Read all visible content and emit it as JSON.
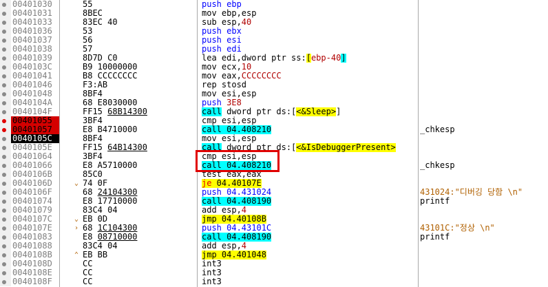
{
  "rows": [
    {
      "addr": "00401030",
      "hex": "55",
      "asm": [
        [
          "push",
          "t-push"
        ],
        [
          " ebp",
          "t-push"
        ]
      ],
      "cmt": "",
      "mark": "dot"
    },
    {
      "addr": "00401031",
      "hex": "8BEC",
      "asm": [
        [
          "mov ebp,esp",
          "t-mn"
        ]
      ],
      "cmt": "",
      "mark": "dot"
    },
    {
      "addr": "00401033",
      "hex": "83EC 40",
      "asm": [
        [
          "sub esp,",
          "t-mn"
        ],
        [
          "40",
          "t-num"
        ]
      ],
      "cmt": "",
      "mark": "dot"
    },
    {
      "addr": "00401036",
      "hex": "53",
      "asm": [
        [
          "push ebx",
          "t-push"
        ]
      ],
      "cmt": "",
      "mark": "dot"
    },
    {
      "addr": "00401037",
      "hex": "56",
      "asm": [
        [
          "push esi",
          "t-push"
        ]
      ],
      "cmt": "",
      "mark": "dot"
    },
    {
      "addr": "00401038",
      "hex": "57",
      "asm": [
        [
          "push edi",
          "t-push"
        ]
      ],
      "cmt": "",
      "mark": "dot"
    },
    {
      "addr": "00401039",
      "hex": "8D7D C0",
      "asm": [
        [
          "lea edi,dword ptr ss:",
          "t-mn"
        ],
        [
          "[",
          "t-api"
        ],
        [
          "ebp-40",
          "t-num"
        ],
        [
          "]",
          "t-call"
        ]
      ],
      "cmt": "",
      "mark": "dot"
    },
    {
      "addr": "0040103C",
      "hex": "B9 10000000",
      "asm": [
        [
          "mov ecx,",
          "t-mn"
        ],
        [
          "10",
          "t-num"
        ]
      ],
      "cmt": "",
      "mark": "dot"
    },
    {
      "addr": "00401041",
      "hex": "B8 CCCCCCCC",
      "asm": [
        [
          "mov eax,",
          "t-mn"
        ],
        [
          "CCCCCCCC",
          "t-num"
        ]
      ],
      "cmt": "",
      "mark": "dot"
    },
    {
      "addr": "00401046",
      "hex": "F3:AB",
      "asm": [
        [
          "rep stosd",
          "t-mn"
        ]
      ],
      "cmt": "",
      "mark": "dot"
    },
    {
      "addr": "00401048",
      "hex": "8BF4",
      "asm": [
        [
          "mov esi,esp",
          "t-mn"
        ]
      ],
      "cmt": "",
      "mark": "dot"
    },
    {
      "addr": "0040104A",
      "hex": "68 E8030000",
      "asm": [
        [
          "push ",
          "t-push"
        ],
        [
          "3E8",
          "t-num"
        ]
      ],
      "cmt": "",
      "mark": "dot"
    },
    {
      "addr": "0040104F",
      "hex": "FF15 ",
      "hexul": "68B14300",
      "asm": [
        [
          "call",
          "t-call"
        ],
        [
          " dword ptr ds:[",
          "t-mn"
        ],
        [
          "<&Sleep>",
          "t-api"
        ],
        [
          "]",
          "t-mn"
        ]
      ],
      "cmt": "",
      "mark": "dot"
    },
    {
      "addr": "00401055",
      "hex": "3BF4",
      "asm": [
        [
          "cmp esi,esp",
          "t-mn"
        ]
      ],
      "cmt": "",
      "mark": "red",
      "addrcls": "bp"
    },
    {
      "addr": "00401057",
      "hex": "E8 B4710000",
      "asm": [
        [
          "call",
          "t-call"
        ],
        [
          " 04.408210",
          "t-call"
        ]
      ],
      "cmt": "_chkesp",
      "mark": "red",
      "addrcls": "bp"
    },
    {
      "addr": "0040105C",
      "hex": "8BF4",
      "asm": [
        [
          "mov esi,esp",
          "t-mn"
        ]
      ],
      "cmt": "",
      "mark": "dot",
      "addrcls": "cur"
    },
    {
      "addr": "0040105E",
      "hex": "FF15 ",
      "hexul": "64B14300",
      "asm": [
        [
          "call",
          "t-call"
        ],
        [
          " dword ptr ds:[",
          "t-mn"
        ],
        [
          "<&IsDebuggerPresent>",
          "t-api"
        ]
      ],
      "cmt": "",
      "mark": "dot"
    },
    {
      "addr": "00401064",
      "hex": "3BF4",
      "asm": [
        [
          "cmp esi,esp",
          "t-mn"
        ]
      ],
      "cmt": "",
      "mark": "dot"
    },
    {
      "addr": "00401066",
      "hex": "E8 A5710000",
      "asm": [
        [
          "call",
          "t-call"
        ],
        [
          " 04.408210",
          "t-call"
        ]
      ],
      "cmt": "_chkesp",
      "mark": "dot"
    },
    {
      "addr": "0040106B",
      "hex": "85C0",
      "asm": [
        [
          "test eax,eax",
          "t-mn"
        ]
      ],
      "cmt": "",
      "mark": "dot"
    },
    {
      "addr": "0040106D",
      "hex": "74 0F",
      "asm": [
        [
          "je",
          "t-jcc"
        ],
        [
          " 04.40107E",
          "t-jmp"
        ]
      ],
      "cmt": "",
      "mark": "dot",
      "jmp": "⌄"
    },
    {
      "addr": "0040106F",
      "hex": "68 ",
      "hexul": "24104300",
      "asm": [
        [
          "push ",
          "t-push"
        ],
        [
          "04.431024",
          "t-push-num"
        ]
      ],
      "cmt": "431024:\"디버깅 당함 \\n\"",
      "cmtcls": "t-cmt-str",
      "mark": "dot"
    },
    {
      "addr": "00401074",
      "hex": "E8 17710000",
      "asm": [
        [
          "call",
          "t-call"
        ],
        [
          " 04.408190",
          "t-call"
        ]
      ],
      "cmt": "printf",
      "mark": "dot"
    },
    {
      "addr": "00401079",
      "hex": "83C4 04",
      "asm": [
        [
          "add esp,",
          "t-mn"
        ],
        [
          "4",
          "t-num"
        ]
      ],
      "cmt": "",
      "mark": "dot"
    },
    {
      "addr": "0040107C",
      "hex": "EB 0D",
      "asm": [
        [
          "jmp",
          "t-jmp"
        ],
        [
          " 04.40108B",
          "t-jmp"
        ]
      ],
      "cmt": "",
      "mark": "dot",
      "jmp": "⌄"
    },
    {
      "addr": "0040107E",
      "hex": "68 ",
      "hexul": "1C104300",
      "asm": [
        [
          "push ",
          "t-push"
        ],
        [
          "04.43101C",
          "t-push-num"
        ]
      ],
      "cmt": "43101C:\"정상 \\n\"",
      "cmtcls": "t-cmt-str",
      "mark": "dot",
      "jmp": "›"
    },
    {
      "addr": "00401083",
      "hex": "E8 ",
      "hexul": "08710000",
      "asm": [
        [
          "call",
          "t-call"
        ],
        [
          " 04.408190",
          "t-call"
        ]
      ],
      "cmt": "printf",
      "mark": "dot"
    },
    {
      "addr": "00401088",
      "hex": "83C4 04",
      "asm": [
        [
          "add esp,",
          "t-mn"
        ],
        [
          "4",
          "t-num"
        ]
      ],
      "cmt": "",
      "mark": "dot"
    },
    {
      "addr": "0040108B",
      "hex": "EB BB",
      "asm": [
        [
          "jmp",
          "t-jmp"
        ],
        [
          " 04.401048",
          "t-jmp"
        ]
      ],
      "cmt": "",
      "mark": "dot",
      "jmp": "⌃"
    },
    {
      "addr": "0040108D",
      "hex": "CC",
      "asm": [
        [
          "int3",
          "t-mn"
        ]
      ],
      "cmt": "",
      "mark": "dot"
    },
    {
      "addr": "0040108E",
      "hex": "CC",
      "asm": [
        [
          "int3",
          "t-mn"
        ]
      ],
      "cmt": "",
      "mark": "dot"
    },
    {
      "addr": "0040108F",
      "hex": "CC",
      "asm": [
        [
          "int3",
          "t-mn"
        ]
      ],
      "cmt": "",
      "mark": "dot"
    }
  ],
  "colors": {
    "breakpoint": "#d40000",
    "current": "#000000",
    "call": "#00ffff",
    "jump": "#ffff00",
    "highlight_box": "#e00000"
  }
}
